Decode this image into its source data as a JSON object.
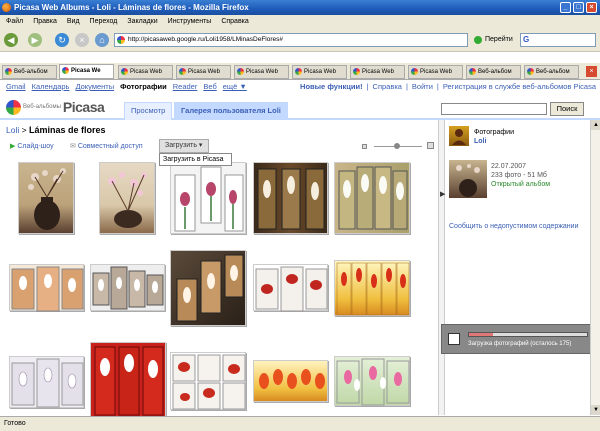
{
  "window": {
    "title": "Picasa Web Albums - Loli - Láminas de flores - Mozilla Firefox"
  },
  "menu": [
    "Файл",
    "Правка",
    "Вид",
    "Переход",
    "Закладки",
    "Инструменты",
    "Справка"
  ],
  "address": {
    "url": "http://picasaweb.google.ru/Loli1958/LMinasDeFlores#",
    "go_label": "Перейти",
    "search_engine": "G"
  },
  "tabs": [
    "Веб-альбом",
    "Picasa We",
    "Picasa Web",
    "Picasa Web",
    "Picasa Web",
    "Picasa Web",
    "Picasa Web",
    "Picasa Web",
    "Веб-альбом",
    "Веб-альбом"
  ],
  "google_bar": {
    "links": [
      "Gmail",
      "Календарь",
      "Документы",
      "Фотографии",
      "Reader",
      "Веб",
      "ещё ▼"
    ],
    "current": "Фотографии",
    "user_links": [
      "Новые функции!",
      "Справка",
      "Войти",
      "Регистрация в службе веб-альбомов Picasa"
    ]
  },
  "header": {
    "logo_small": "Веб-альбомы",
    "logo_big": "Picasa",
    "tab_view": "Просмотр",
    "tab_gallery": "Галерея пользователя Loli",
    "search_button": "Поиск"
  },
  "breadcrumb": {
    "user": "Loli",
    "sep": ">",
    "album": "Láminas de flores"
  },
  "actions": {
    "slideshow": "Слайд-шоу",
    "share": "Совместный доступ",
    "upload": "Загрузить",
    "upload_menu": "Загрузить в Picasa"
  },
  "sidebar": {
    "owner_label": "Фотографии",
    "owner_name": "Loli",
    "date": "22.07.2007",
    "stats": "233 фото - 51 Мб",
    "visibility": "Открытый альбом",
    "report_link": "Сообщить о недопустимом содержании"
  },
  "upload_progress": {
    "text": "Загрузка фотографий (осталось 175)",
    "fraction": 0.2
  },
  "status": "Готово",
  "colors": {
    "link": "#3b5fb5",
    "green": "#2a8a2a",
    "tab_active": "#c3d9ff"
  }
}
